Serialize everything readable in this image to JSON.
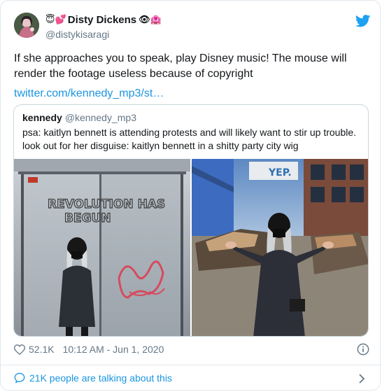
{
  "tweet": {
    "author_name": "Disty Dickens",
    "name_prefix_emoji": "😇💕",
    "name_suffix_emoji": "👁🏩",
    "author_handle": "@distykisaragi",
    "text": "If she approaches you to speak, play Disney music! The mouse will render the footage useless because of copyright",
    "link": "twitter.com/kennedy_mp3/st…"
  },
  "quoted": {
    "name": "kennedy",
    "handle": "@kennedy_mp3",
    "text": "psa: kaitlyn bennett is attending protests and will likely want to stir up trouble. look out for her disguise: kaitlyn bennett in a shitty party city wig",
    "photo_left_graffiti": [
      "REVOLUTION HAS",
      "BEGUN"
    ],
    "photo_right_sign": "YEP."
  },
  "meta": {
    "likes": "52.1K",
    "timestamp": "10:12 AM - Jun 1, 2020"
  },
  "footer": {
    "talking": "21K people are talking about this"
  },
  "icons": {
    "bird": "twitter-bird-icon",
    "heart": "heart-outline-icon",
    "info": "info-icon",
    "comment": "comment-bubble-icon",
    "chevron": "chevron-right-icon"
  },
  "colors": {
    "link": "#1b95e0",
    "secondary_text": "#657786",
    "border": "#e1e8ed"
  }
}
